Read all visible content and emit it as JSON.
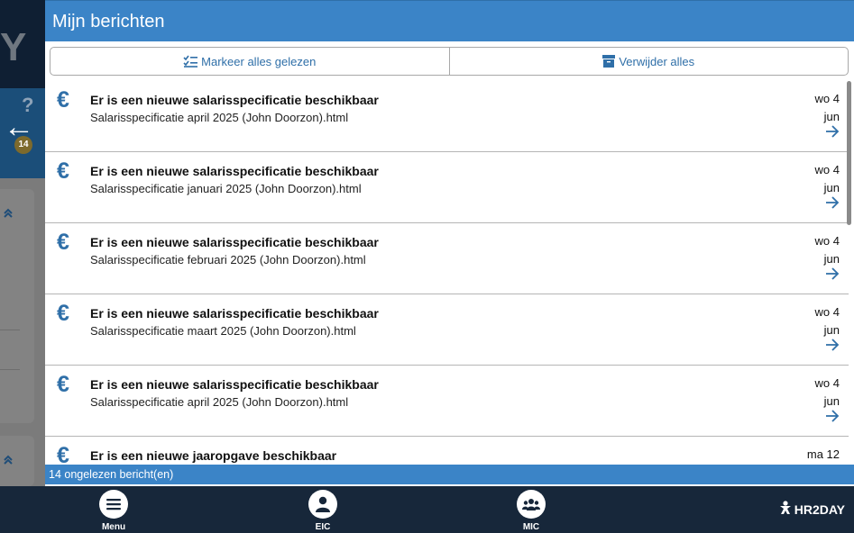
{
  "background": {
    "logo_fragment": "Y",
    "help_glyph": "?",
    "back_glyph": "←",
    "badge_count": "14",
    "chevron_glyph": "«"
  },
  "dialog": {
    "title": "Mijn berichten",
    "actions": {
      "mark_all_read": "Markeer alles gelezen",
      "delete_all": "Verwijder alles"
    },
    "messages": [
      {
        "icon": "euro-icon",
        "title": "Er is een nieuwe salarisspecificatie beschikbaar",
        "subtitle": "Salarisspecificatie april 2025 (John Doorzon).html",
        "date_line1": "wo 4",
        "date_line2": "jun"
      },
      {
        "icon": "euro-icon",
        "title": "Er is een nieuwe salarisspecificatie beschikbaar",
        "subtitle": "Salarisspecificatie januari 2025 (John Doorzon).html",
        "date_line1": "wo 4",
        "date_line2": "jun"
      },
      {
        "icon": "euro-icon",
        "title": "Er is een nieuwe salarisspecificatie beschikbaar",
        "subtitle": "Salarisspecificatie februari 2025 (John Doorzon).html",
        "date_line1": "wo 4",
        "date_line2": "jun"
      },
      {
        "icon": "euro-icon",
        "title": "Er is een nieuwe salarisspecificatie beschikbaar",
        "subtitle": "Salarisspecificatie maart 2025 (John Doorzon).html",
        "date_line1": "wo 4",
        "date_line2": "jun"
      },
      {
        "icon": "euro-icon",
        "title": "Er is een nieuwe salarisspecificatie beschikbaar",
        "subtitle": "Salarisspecificatie april 2025 (John Doorzon).html",
        "date_line1": "wo 4",
        "date_line2": "jun"
      },
      {
        "icon": "euro-icon",
        "title": "Er is een nieuwe jaaropgave beschikbaar",
        "subtitle": "",
        "date_line1": "ma 12",
        "date_line2": ""
      }
    ],
    "status": "14 ongelezen bericht(en)"
  },
  "bottom_nav": {
    "items": [
      {
        "label": "Menu",
        "icon": "hamburger-icon"
      },
      {
        "label": "EIC",
        "icon": "person-icon"
      },
      {
        "label": "MIC",
        "icon": "group-icon"
      }
    ],
    "brand": "HR2DAY"
  },
  "colors": {
    "accent": "#3b84c7",
    "link": "#2f6fa8",
    "nav_bg": "#17273a"
  }
}
